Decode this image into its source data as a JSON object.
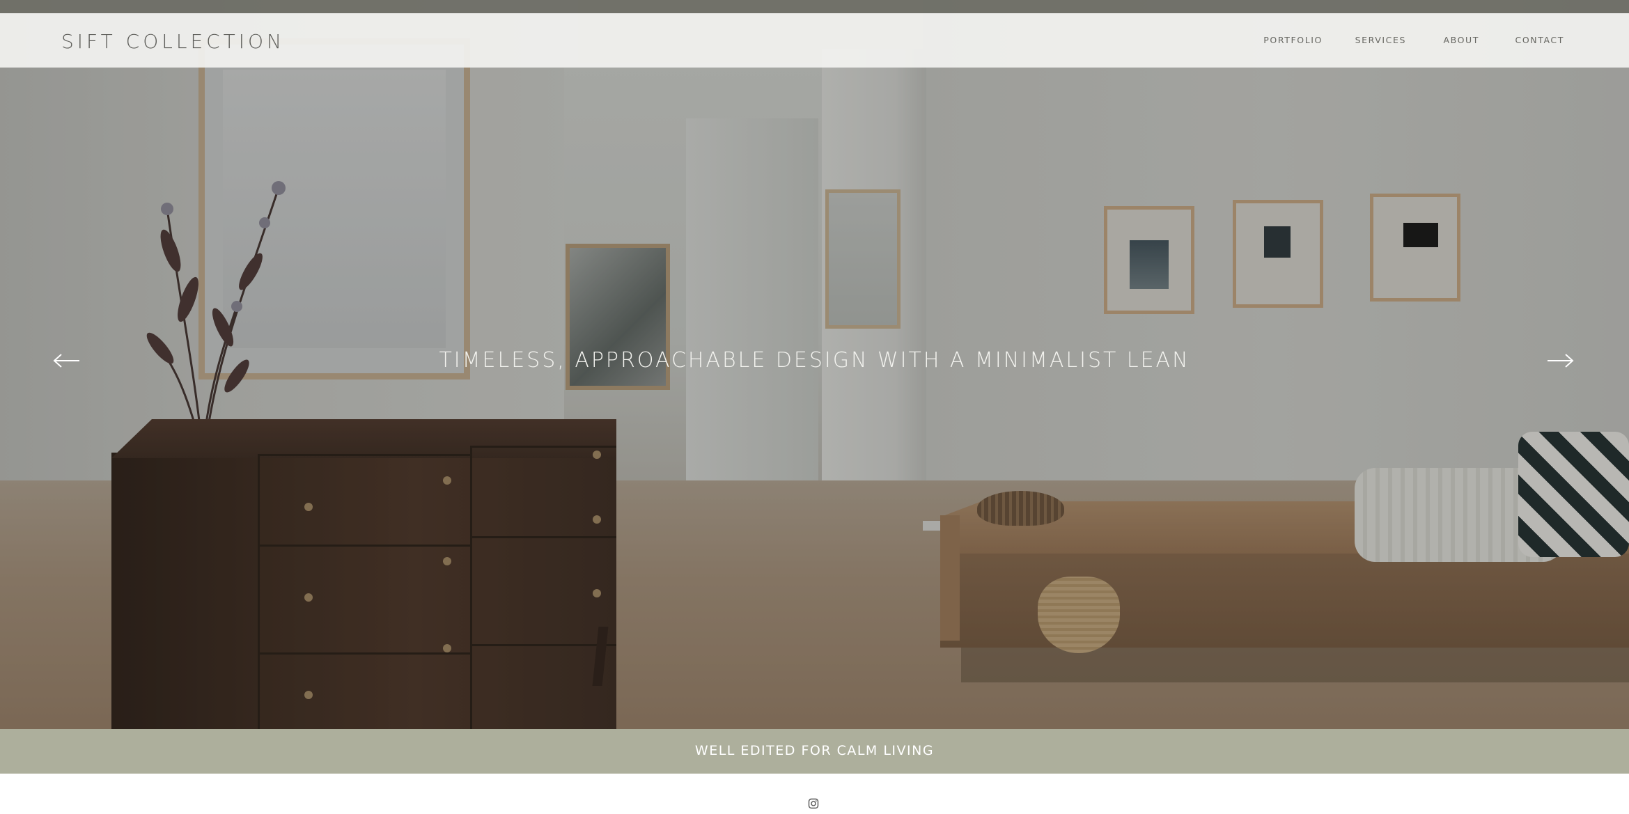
{
  "brand": {
    "logo_text": "SIFT COLLECTION"
  },
  "nav": {
    "items": [
      {
        "label": "PORTFOLIO"
      },
      {
        "label": "SERVICES"
      },
      {
        "label": "ABOUT"
      },
      {
        "label": "CONTACT"
      }
    ]
  },
  "hero": {
    "headline": "TIMELESS, APPROACHABLE DESIGN WITH A MINIMALIST LEAN",
    "prev_icon": "arrow-left-icon",
    "next_icon": "arrow-right-icon"
  },
  "band": {
    "tagline": "WELL EDITED FOR CALM LIVING"
  },
  "footer": {
    "social_icon": "instagram-icon"
  },
  "colors": {
    "band_background": "#adaf9c",
    "header_background": "#f3f3f1",
    "text_dark": "#5e5e5a",
    "text_light": "#ffffff"
  }
}
